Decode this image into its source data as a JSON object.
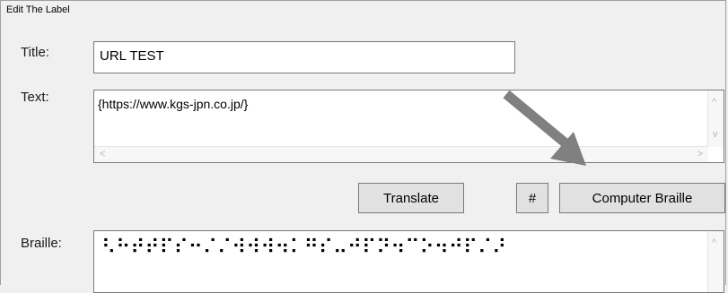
{
  "dialog": {
    "title": "Edit The Label"
  },
  "title_field": {
    "label": "Title:",
    "value": "URL TEST"
  },
  "text_field": {
    "label": "Text:",
    "value": "{https://www.kgs-jpn.co.jp/}",
    "scroll_up": "^",
    "scroll_down": "v",
    "scroll_left": "<",
    "scroll_right": ">"
  },
  "buttons": {
    "translate": "Translate",
    "hash": "#",
    "computer_braille": "Computer Braille"
  },
  "braille_field": {
    "label": "Braille:",
    "value": "⠣⠓⠞⠞⠏⠎⠒⠌⠌⠺⠺⠺⠲⠅⠛⠎⠤⠚⠏⠝⠲⠉⠕⠲⠚⠏⠌⠜",
    "scroll_up": "^"
  },
  "annotation": {
    "arrow_color": "#808080",
    "icon": "arrow-pointer-icon"
  }
}
